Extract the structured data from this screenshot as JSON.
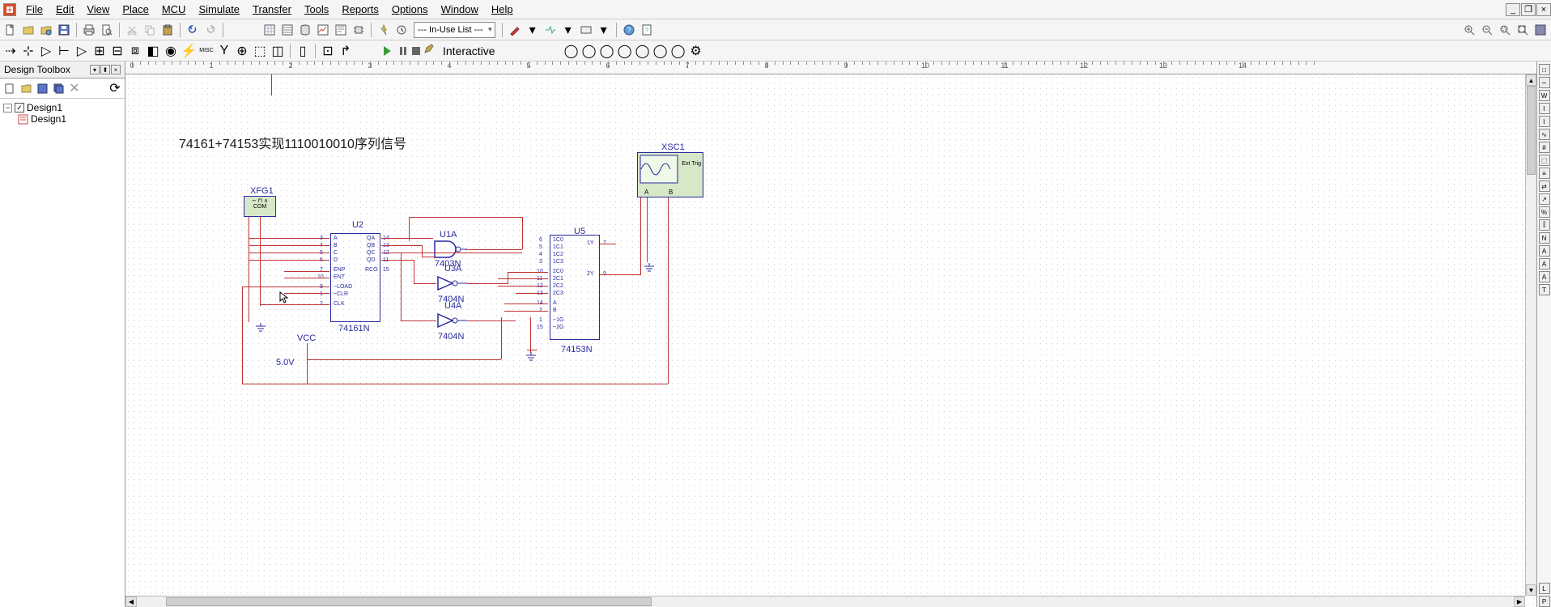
{
  "menu": {
    "items": [
      "File",
      "Edit",
      "View",
      "Place",
      "MCU",
      "Simulate",
      "Transfer",
      "Tools",
      "Reports",
      "Options",
      "Window",
      "Help"
    ]
  },
  "toolbar": {
    "in_use": "--- In-Use List ---",
    "interactive_label": "Interactive"
  },
  "sidebar": {
    "title": "Design Toolbox",
    "root": "Design1",
    "child": "Design1"
  },
  "ruler": {
    "marks": [
      "0",
      "1",
      "2",
      "3",
      "4",
      "5",
      "6",
      "7",
      "8",
      "9",
      "10",
      "11",
      "12",
      "13",
      "14"
    ]
  },
  "schematic": {
    "title": "74161+74153实现1110010010序列信号",
    "xfg1": "XFG1",
    "xfg1_com": "COM",
    "xsc1": "XSC1",
    "xsc1_ext": "Ext Trig",
    "xsc1_a": "A",
    "xsc1_b": "B",
    "u2_ref": "U2",
    "u2_val": "74161N",
    "u2_pins_left": [
      "A",
      "B",
      "C",
      "D",
      "ENP",
      "ENT",
      "~LOAD",
      "~CLR",
      "CLK"
    ],
    "u2_pins_left_nums": [
      "3",
      "4",
      "5",
      "6",
      "7",
      "10",
      "9",
      "1",
      "2"
    ],
    "u2_pins_right": [
      "QA",
      "QB",
      "QC",
      "QD",
      "RCO"
    ],
    "u2_pins_right_nums": [
      "14",
      "13",
      "12",
      "11",
      "15"
    ],
    "u1a_ref": "U1A",
    "u1a_val": "7403N",
    "u3a_ref": "U3A",
    "u3a_val": "7404N",
    "u4a_ref": "U4A",
    "u4a_val": "7404N",
    "u5_ref": "U5",
    "u5_val": "74153N",
    "u5_pins_left": [
      "1C0",
      "1C1",
      "1C2",
      "1C3",
      "2C0",
      "2C1",
      "2C2",
      "2C3",
      "A",
      "B",
      "~1G",
      "~2G"
    ],
    "u5_pins_left_nums": [
      "6",
      "5",
      "4",
      "3",
      "10",
      "11",
      "12",
      "13",
      "14",
      "2",
      "1",
      "15"
    ],
    "u5_pins_right": [
      "1Y",
      "2Y"
    ],
    "u5_pins_right_nums": [
      "7",
      "9"
    ],
    "vcc": "VCC",
    "vcc_val": "5.0V"
  }
}
